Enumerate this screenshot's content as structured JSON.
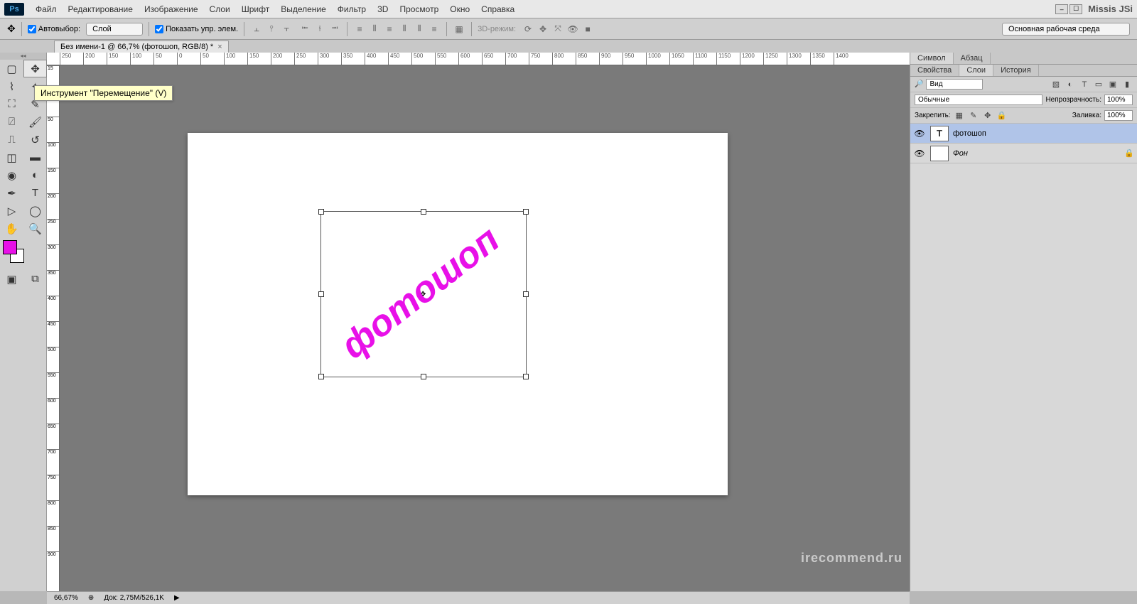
{
  "app": {
    "logo": "Ps",
    "user": "Missis JSi"
  },
  "menu": [
    "Файл",
    "Редактирование",
    "Изображение",
    "Слои",
    "Шрифт",
    "Выделение",
    "Фильтр",
    "3D",
    "Просмотр",
    "Окно",
    "Справка"
  ],
  "options": {
    "auto_select_label": "Автовыбор:",
    "auto_select_value": "Слой",
    "show_controls_label": "Показать упр. элем.",
    "mode3d": "3D-режим:",
    "workspace": "Основная рабочая среда"
  },
  "document": {
    "tab_title": "Без имени-1 @ 66,7% (фотошоп, RGB/8) *",
    "canvas_text": "фотошоп"
  },
  "tooltip": "Инструмент \"Перемещение\" (V)",
  "ruler_h": [
    -250,
    -200,
    -150,
    -100,
    -50,
    0,
    50,
    100,
    150,
    200,
    250,
    300,
    350,
    400,
    450,
    500,
    550,
    600,
    650,
    700,
    750,
    800,
    850,
    900,
    950,
    1000,
    1050,
    1100,
    1150,
    1200,
    1250,
    1300,
    1350,
    1400
  ],
  "ruler_v_labels": [
    "1 5",
    "0",
    "5 0",
    "1 0 0",
    "1 5 0",
    "2 0 0",
    "2 5 0",
    "3 0 0",
    "3 5 0",
    "4 0 0",
    "4 5 0",
    "5 0 0",
    "5 5 0",
    "6 0 0",
    "6 5 0",
    "7 0 0",
    "7 5 0",
    "8 0 0",
    "8 5 0",
    "9 0 0"
  ],
  "panels": {
    "top_tabs": [
      "Символ",
      "Абзац"
    ],
    "mid_tabs": [
      "Свойства",
      "Слои",
      "История"
    ],
    "filter_label": "Вид",
    "blend_mode": "Обычные",
    "opacity_label": "Непрозрачность:",
    "opacity_value": "100%",
    "lock_label": "Закрепить:",
    "fill_label": "Заливка:",
    "fill_value": "100%",
    "layers": [
      {
        "name": "фотошоп",
        "type": "text",
        "visible": true,
        "selected": true
      },
      {
        "name": "Фон",
        "type": "bg",
        "visible": true,
        "locked": true
      }
    ]
  },
  "status": {
    "zoom": "66,67%",
    "doc": "Док: 2,75M/526,1K"
  },
  "colors": {
    "fg": "#e810e8",
    "bg": "#ffffff"
  },
  "watermark": "irecommend.ru"
}
